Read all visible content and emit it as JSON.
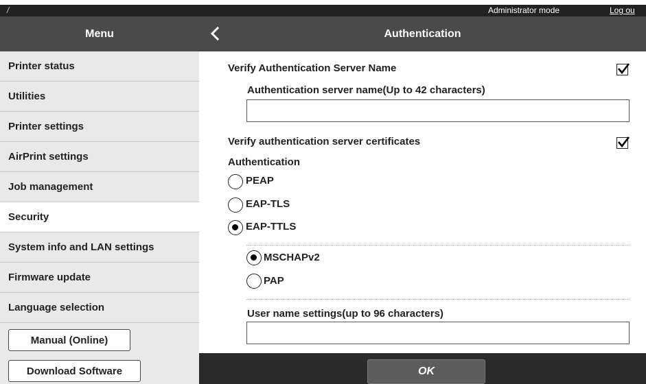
{
  "topbar": {
    "slash": "/",
    "mode_label": "Administrator mode",
    "logout_label": "Log ou"
  },
  "menu_header": {
    "title": "Menu"
  },
  "page_header": {
    "title": "Authentication",
    "back_icon": "chevron-left-icon"
  },
  "sidebar": {
    "items": [
      {
        "label": "Printer status",
        "active": false
      },
      {
        "label": "Utilities",
        "active": false
      },
      {
        "label": "Printer settings",
        "active": false
      },
      {
        "label": "AirPrint settings",
        "active": false
      },
      {
        "label": "Job management",
        "active": false
      },
      {
        "label": "Security",
        "active": true
      },
      {
        "label": "System info and LAN settings",
        "active": false
      },
      {
        "label": "Firmware update",
        "active": false
      },
      {
        "label": "Language selection",
        "active": false
      }
    ],
    "buttons": {
      "manual": "Manual (Online)",
      "download": "Download Software"
    }
  },
  "form": {
    "verify_server_name": {
      "label": "Verify Authentication Server Name",
      "checked": true
    },
    "server_name": {
      "label": "Authentication server name(Up to 42 characters)",
      "value": ""
    },
    "verify_certificates": {
      "label": "Verify authentication server certificates",
      "checked": true
    },
    "authentication": {
      "label": "Authentication",
      "options": [
        "PEAP",
        "EAP-TLS",
        "EAP-TTLS"
      ],
      "selected": "EAP-TTLS"
    },
    "inner_method": {
      "options": [
        "MSCHAPv2",
        "PAP"
      ],
      "selected": "MSCHAPv2"
    },
    "user_name": {
      "label": "User name settings(up to 96 characters)",
      "value": ""
    }
  },
  "footer": {
    "ok_label": "OK"
  },
  "colors": {
    "header_bg": "#4a4a4a",
    "topbar_bg": "#222222",
    "sidebar_bg": "#e9e9e9",
    "footer_bg": "#2a2a2a",
    "ok_button_bg": "#5c5c5c"
  }
}
